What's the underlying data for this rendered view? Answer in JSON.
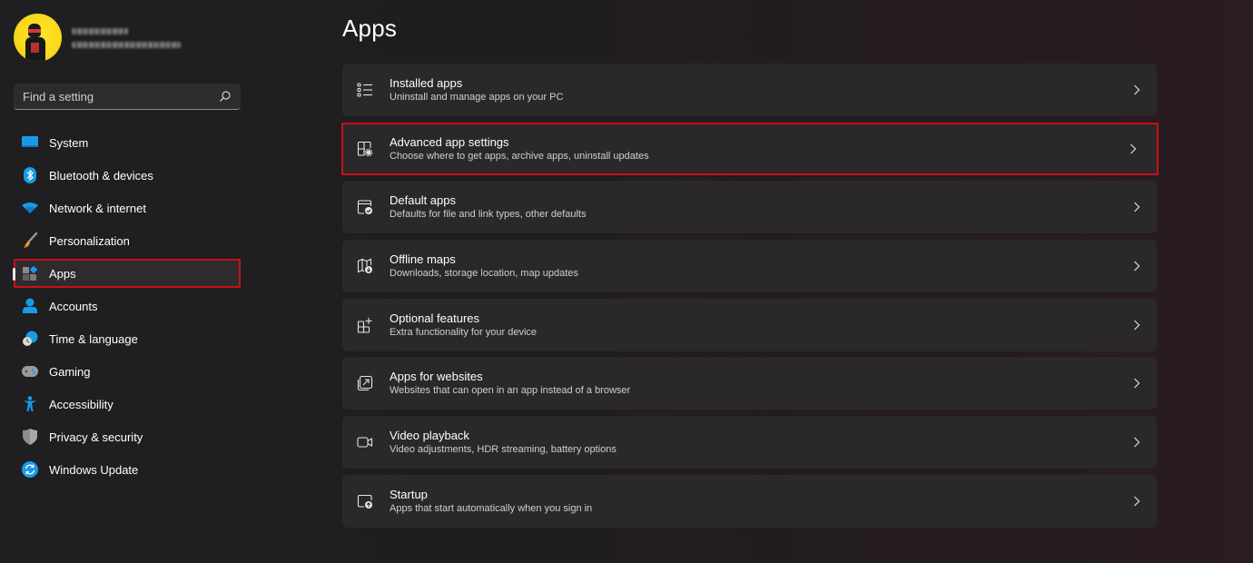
{
  "profile": {
    "name_redacted": true,
    "email_redacted": true
  },
  "search": {
    "placeholder": "Find a setting",
    "value": ""
  },
  "sidebar": {
    "items": [
      {
        "label": "System",
        "icon": "system-icon",
        "active": false
      },
      {
        "label": "Bluetooth & devices",
        "icon": "bluetooth-icon",
        "active": false
      },
      {
        "label": "Network & internet",
        "icon": "wifi-icon",
        "active": false
      },
      {
        "label": "Personalization",
        "icon": "brush-icon",
        "active": false
      },
      {
        "label": "Apps",
        "icon": "apps-icon",
        "active": true
      },
      {
        "label": "Accounts",
        "icon": "person-icon",
        "active": false
      },
      {
        "label": "Time & language",
        "icon": "clock-globe-icon",
        "active": false
      },
      {
        "label": "Gaming",
        "icon": "gamepad-icon",
        "active": false
      },
      {
        "label": "Accessibility",
        "icon": "accessibility-icon",
        "active": false
      },
      {
        "label": "Privacy & security",
        "icon": "shield-icon",
        "active": false
      },
      {
        "label": "Windows Update",
        "icon": "update-icon",
        "active": false
      }
    ]
  },
  "main": {
    "title": "Apps",
    "cards": [
      {
        "title": "Installed apps",
        "subtitle": "Uninstall and manage apps on your PC",
        "icon": "list-icon",
        "highlighted": false
      },
      {
        "title": "Advanced app settings",
        "subtitle": "Choose where to get apps, archive apps, uninstall updates",
        "icon": "app-settings-icon",
        "highlighted": true
      },
      {
        "title": "Default apps",
        "subtitle": "Defaults for file and link types, other defaults",
        "icon": "default-apps-icon",
        "highlighted": false
      },
      {
        "title": "Offline maps",
        "subtitle": "Downloads, storage location, map updates",
        "icon": "map-download-icon",
        "highlighted": false
      },
      {
        "title": "Optional features",
        "subtitle": "Extra functionality for your device",
        "icon": "add-feature-icon",
        "highlighted": false
      },
      {
        "title": "Apps for websites",
        "subtitle": "Websites that can open in an app instead of a browser",
        "icon": "open-external-icon",
        "highlighted": false
      },
      {
        "title": "Video playback",
        "subtitle": "Video adjustments, HDR streaming, battery options",
        "icon": "video-icon",
        "highlighted": false
      },
      {
        "title": "Startup",
        "subtitle": "Apps that start automatically when you sign in",
        "icon": "startup-icon",
        "highlighted": false
      }
    ]
  },
  "colors": {
    "accent": "#0f8ce0",
    "highlight_border": "#c8101a",
    "card_bg": "#2b282b"
  }
}
